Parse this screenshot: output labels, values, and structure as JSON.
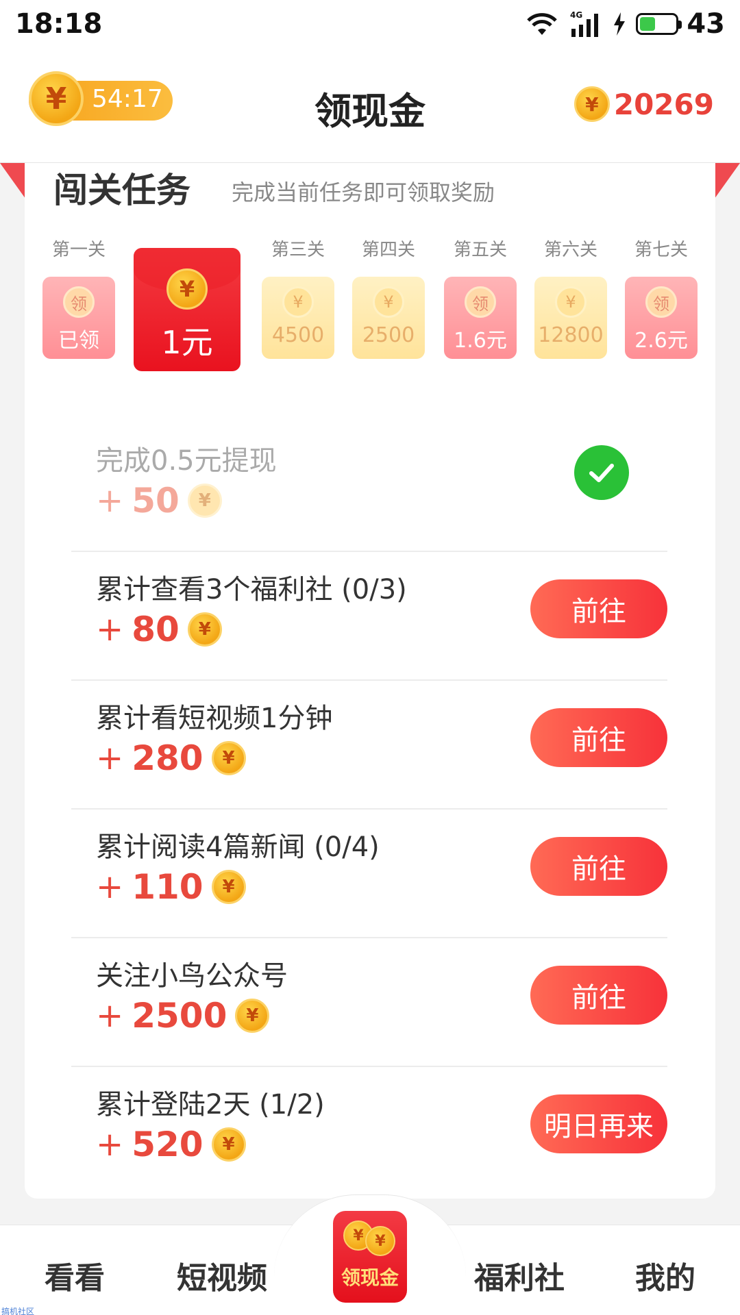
{
  "status_bar": {
    "time": "18:18",
    "network": "4G",
    "battery": "43",
    "battery_level": 0.43
  },
  "header": {
    "timer": "54:17",
    "title": "领现金",
    "coin_balance": "20269",
    "coin_symbol": "¥"
  },
  "challenge": {
    "title": "闯关任务",
    "subtitle": "完成当前任务即可领取奖励",
    "stages": [
      {
        "label": "第一关",
        "value": "已领",
        "icon": "领",
        "style": "pink"
      },
      {
        "label": "",
        "value": "1元",
        "icon": "¥",
        "style": "current"
      },
      {
        "label": "第三关",
        "value": "4500",
        "icon": "¥",
        "style": "gold"
      },
      {
        "label": "第四关",
        "value": "2500",
        "icon": "¥",
        "style": "gold"
      },
      {
        "label": "第五关",
        "value": "1.6元",
        "icon": "领",
        "style": "pink"
      },
      {
        "label": "第六关",
        "value": "12800",
        "icon": "¥",
        "style": "gold"
      },
      {
        "label": "第七关",
        "value": "2.6元",
        "icon": "领",
        "style": "pink"
      }
    ]
  },
  "tasks": [
    {
      "title": "完成0.5元提现",
      "reward": "50",
      "plus": "+",
      "status": "done"
    },
    {
      "title": "累计查看3个福利社 (0/3)",
      "reward": "80",
      "plus": "+",
      "button": "前往"
    },
    {
      "title": "累计看短视频1分钟",
      "reward": "280",
      "plus": "+",
      "button": "前往"
    },
    {
      "title": "累计阅读4篇新闻 (0/4)",
      "reward": "110",
      "plus": "+",
      "button": "前往"
    },
    {
      "title": "关注小鸟公众号",
      "reward": "2500",
      "plus": "+",
      "button": "前往"
    },
    {
      "title": "累计登陆2天 (1/2)",
      "reward": "520",
      "plus": "+",
      "button": "明日再来"
    }
  ],
  "bottom_nav": {
    "items": [
      "看看",
      "短视频",
      "领现金",
      "福利社",
      "我的"
    ],
    "active": "领现金"
  },
  "watermark": "搞机社区",
  "colors": {
    "accent": "#e8423a",
    "success": "#2ac137",
    "coin": "#f3a615"
  }
}
